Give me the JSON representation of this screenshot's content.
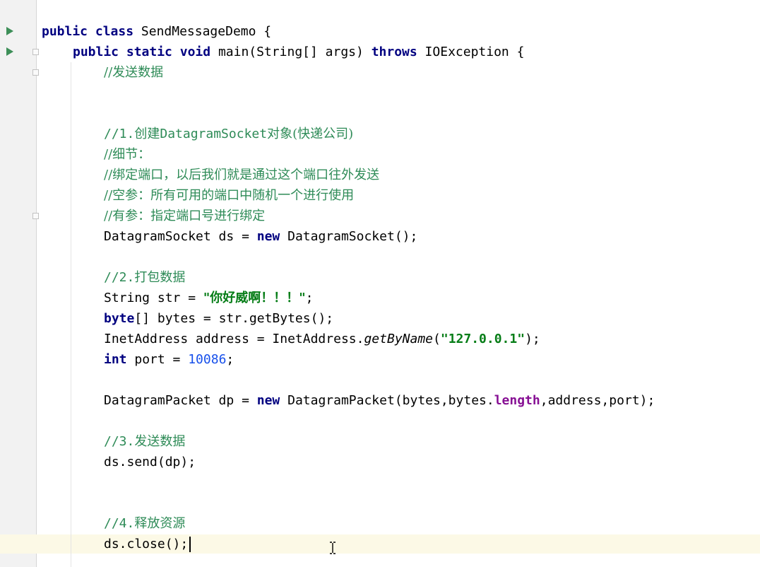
{
  "editor": {
    "lines": [
      {
        "id": "l1",
        "parts": [
          [
            "kw",
            "public"
          ],
          [
            "",
            "&nbsp;"
          ],
          [
            "kw",
            "class"
          ],
          [
            "",
            "&nbsp;SendMessageDemo&nbsp;{"
          ]
        ]
      },
      {
        "id": "l2",
        "parts": [
          [
            "kw",
            "public"
          ],
          [
            "",
            "&nbsp;"
          ],
          [
            "kw",
            "static"
          ],
          [
            "",
            "&nbsp;"
          ],
          [
            "kw",
            "void"
          ],
          [
            "",
            "&nbsp;main(String[]&nbsp;args)&nbsp;"
          ],
          [
            "kw",
            "throws"
          ],
          [
            "",
            "&nbsp;IOException&nbsp;{"
          ]
        ]
      }
    ],
    "text": {
      "class_decl_kw1": "public",
      "class_decl_kw2": "class",
      "class_decl_rest": " SendMessageDemo {",
      "main_kw1": "public",
      "main_kw2": "static",
      "main_kw3": "void",
      "main_sig": " main(String[] args) ",
      "main_throws": "throws",
      "main_exc": " IOException {",
      "comment_send_data": "//发送数据",
      "comment_1_prefix": "//1.",
      "comment_1_a": "创建",
      "comment_1_b": "DatagramSocket",
      "comment_1_c": "对象(快递公司)",
      "comment_detail": "//细节：",
      "comment_bind": "//绑定端口，以后我们就是通过这个端口往外发送",
      "comment_empty": "//空参：所有可用的端口中随机一个进行使用",
      "comment_param": "//有参：指定端口号进行绑定",
      "ds_decl_a": "DatagramSocket ds = ",
      "ds_decl_new": "new",
      "ds_decl_b": " DatagramSocket();",
      "comment_2_prefix": "//2.",
      "comment_2_text": "打包数据",
      "str_decl_a": "String str = ",
      "str_value": "\"你好威啊！！！\"",
      "str_decl_b": ";",
      "bytes_kw": "byte",
      "bytes_rest": "[] bytes = str.getBytes();",
      "addr_a": "InetAddress address = InetAddress.",
      "addr_method": "getByName",
      "addr_b": "(",
      "addr_value": "\"127.0.0.1\"",
      "addr_c": ");",
      "port_kw": "int",
      "port_a": " port = ",
      "port_value": "10086",
      "port_b": ";",
      "dp_a": "DatagramPacket dp = ",
      "dp_new": "new",
      "dp_b": " DatagramPacket(bytes,bytes.",
      "dp_field": "length",
      "dp_c": ",address,port);",
      "comment_3_prefix": "//3.",
      "comment_3_text": "发送数据",
      "send_call": "ds.send(dp);",
      "comment_4_prefix": "//4.",
      "comment_4_text": "释放资源",
      "close_call": "ds.close();"
    }
  },
  "colors": {
    "keyword": "#000080",
    "comment": "#2e8b57",
    "string": "#067d17",
    "number": "#1750eb",
    "field": "#871094",
    "current_line": "#fcf9e6",
    "gutter": "#f2f2f2",
    "run_icon": "#3d8f58"
  },
  "icons": {
    "run_class": "run-icon",
    "run_main": "run-icon",
    "fold": "fold-icon",
    "mouse": "text-cursor-icon"
  }
}
